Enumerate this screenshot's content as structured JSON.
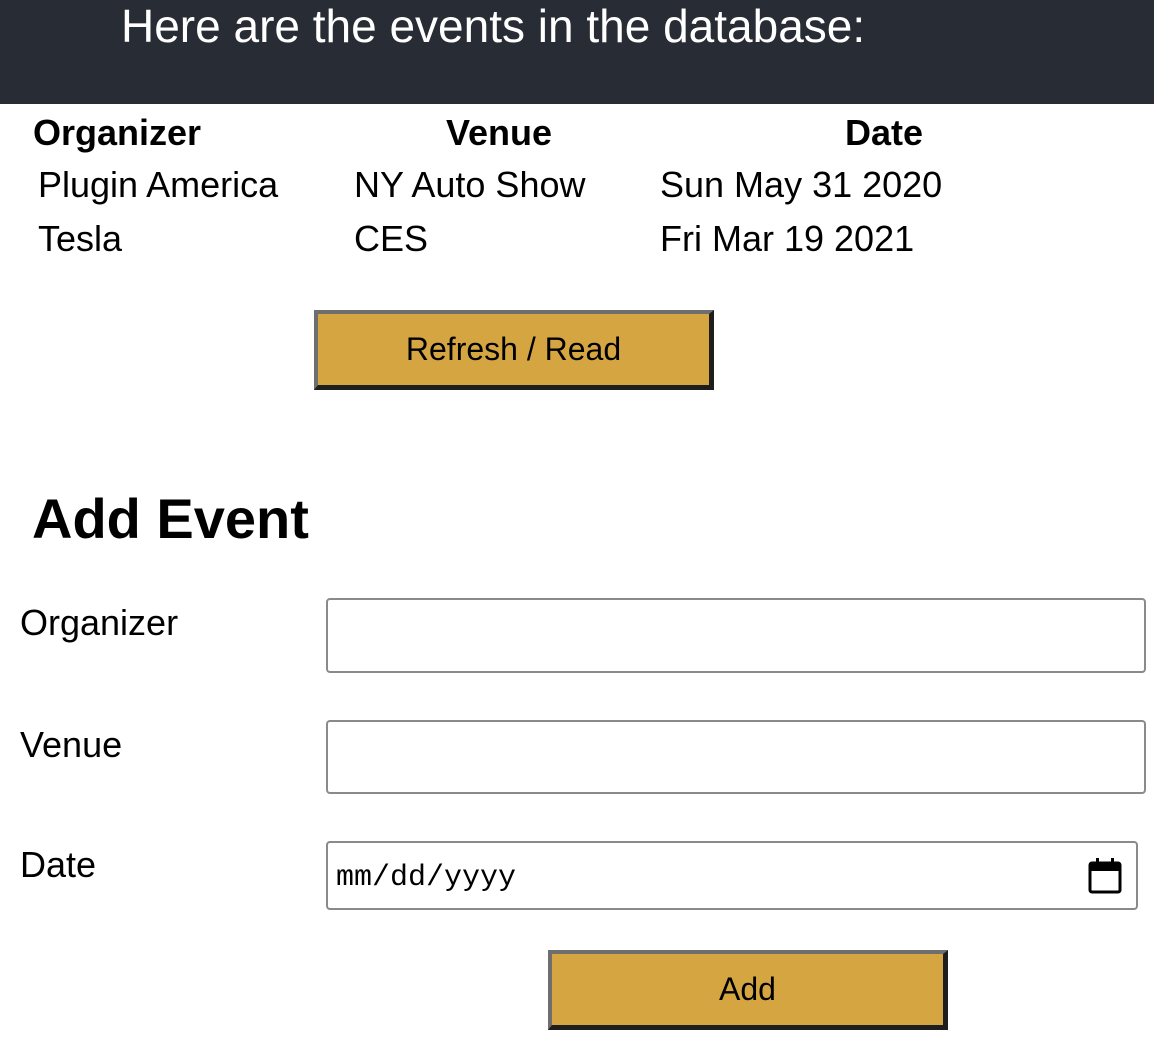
{
  "header": {
    "title": "Here are the events in the database:",
    "background": "#282c34"
  },
  "events_table": {
    "columns": [
      "Organizer",
      "Venue",
      "Date"
    ],
    "rows": [
      [
        "Plugin America",
        "NY Auto Show",
        "Sun May 31 2020"
      ],
      [
        "Tesla",
        "CES",
        "Fri Mar 19 2021"
      ]
    ]
  },
  "refresh_button": {
    "label": "Refresh / Read",
    "color": "#d4a541"
  },
  "add_form": {
    "title": "Add Event",
    "organizer_label": "Organizer",
    "organizer_value": "",
    "venue_label": "Venue",
    "venue_value": "",
    "date_label": "Date",
    "date_placeholder": "mm/dd/yyyy",
    "date_icon": "calendar-icon",
    "submit_label": "Add"
  }
}
